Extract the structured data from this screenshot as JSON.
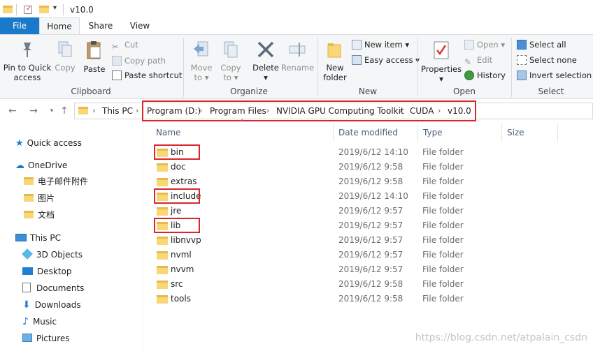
{
  "window": {
    "title": "v10.0"
  },
  "ribbon_tabs": [
    "File",
    "Home",
    "Share",
    "View"
  ],
  "clipboard": {
    "pin_label_1": "Pin to Quick",
    "pin_label_2": "access",
    "copy": "Copy",
    "paste": "Paste",
    "cut": "Cut",
    "copy_path": "Copy path",
    "paste_shortcut": "Paste shortcut",
    "group": "Clipboard"
  },
  "organize": {
    "move_to_1": "Move",
    "move_to_2": "to ▾",
    "copy_to_1": "Copy",
    "copy_to_2": "to ▾",
    "delete_1": "Delete",
    "delete_2": "▾",
    "rename": "Rename",
    "group": "Organize"
  },
  "new": {
    "new_folder_1": "New",
    "new_folder_2": "folder",
    "new_item": "New item ▾",
    "easy_access": "Easy access ▾",
    "group": "New"
  },
  "open": {
    "properties_1": "Properties",
    "properties_2": "▾",
    "open": "Open ▾",
    "edit": "Edit",
    "history": "History",
    "group": "Open"
  },
  "select": {
    "select_all": "Select all",
    "select_none": "Select none",
    "invert": "Invert selection",
    "group": "Select"
  },
  "breadcrumb": [
    "This PC",
    "Program (D:)",
    "Program Files",
    "NVIDIA GPU Computing Toolkit",
    "CUDA",
    "v10.0"
  ],
  "sidebar": {
    "quick_access": "Quick access",
    "onedrive": "OneDrive",
    "onedrive_items": [
      "电子邮件附件",
      "图片",
      "文档"
    ],
    "this_pc": "This PC",
    "pc_items": [
      "3D Objects",
      "Desktop",
      "Documents",
      "Downloads",
      "Music",
      "Pictures"
    ]
  },
  "columns": {
    "name": "Name",
    "date": "Date modified",
    "type": "Type",
    "size": "Size"
  },
  "files": [
    {
      "name": "bin",
      "date": "2019/6/12 14:10",
      "type": "File folder"
    },
    {
      "name": "doc",
      "date": "2019/6/12 9:58",
      "type": "File folder"
    },
    {
      "name": "extras",
      "date": "2019/6/12 9:58",
      "type": "File folder"
    },
    {
      "name": "include",
      "date": "2019/6/12 14:10",
      "type": "File folder"
    },
    {
      "name": "jre",
      "date": "2019/6/12 9:57",
      "type": "File folder"
    },
    {
      "name": "lib",
      "date": "2019/6/12 9:57",
      "type": "File folder"
    },
    {
      "name": "libnvvp",
      "date": "2019/6/12 9:57",
      "type": "File folder"
    },
    {
      "name": "nvml",
      "date": "2019/6/12 9:57",
      "type": "File folder"
    },
    {
      "name": "nvvm",
      "date": "2019/6/12 9:57",
      "type": "File folder"
    },
    {
      "name": "src",
      "date": "2019/6/12 9:58",
      "type": "File folder"
    },
    {
      "name": "tools",
      "date": "2019/6/12 9:58",
      "type": "File folder"
    }
  ],
  "watermark": "https://blog.csdn.net/atpalain_csdn",
  "colors": {
    "accent": "#1979ca",
    "highlight": "#d9262c",
    "folder": "#f8d775"
  }
}
